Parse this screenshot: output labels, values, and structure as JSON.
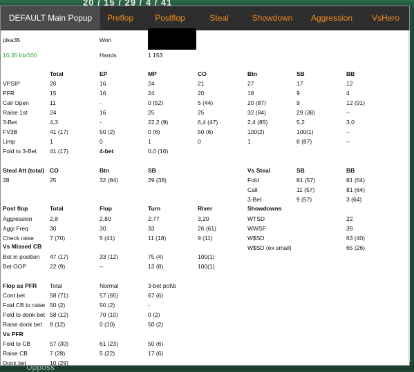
{
  "topbar": {
    "text": "20 / 15 / 29 / 4 / 41"
  },
  "bottom": {
    "text": "Upposs"
  },
  "tabs": [
    "DEFAULT Main Popup",
    "Preflop",
    "Postflop",
    "Steal",
    "Showdown",
    "Aggression",
    "VsHero"
  ],
  "player": {
    "name": "pika35",
    "won_label": "Won",
    "winrate": "10,35 bb/100",
    "hands_label": "Hands",
    "hands": "1 153"
  },
  "preflop": {
    "headers": [
      "Total",
      "EP",
      "MP",
      "CO",
      "Btn",
      "SB",
      "BB"
    ],
    "rows": [
      {
        "label": "VPSIP",
        "values": [
          "20",
          "16",
          "24",
          "21",
          "27",
          "17",
          "12"
        ]
      },
      {
        "label": "PFR",
        "values": [
          "15",
          "16",
          "24",
          "20",
          "18",
          "9",
          "4"
        ]
      },
      {
        "label": "Call Open",
        "values": [
          "11",
          "-",
          "0 (52)",
          "5 (44)",
          "20 (87)",
          "9",
          "12 (91)"
        ]
      },
      {
        "label": "Raise 1st",
        "values": [
          "24",
          "16",
          "25",
          "25",
          "32 (84)",
          "29 (38)",
          "--"
        ]
      },
      {
        "label": "3-Bet",
        "values": [
          "4,3",
          "-",
          "22,2 (9)",
          "6,4 (47)",
          "2,4 (85)",
          "5,2",
          "3,0"
        ]
      },
      {
        "label": "FV3B",
        "values": [
          "41 (17)",
          "50 (2)",
          "0 (6)",
          "50 (6)",
          "100(2)",
          "100(1)",
          "--"
        ]
      },
      {
        "label": "Limp",
        "values": [
          "1",
          "0",
          "1",
          "0",
          "1",
          "8 (87)",
          "--"
        ]
      },
      {
        "label": "Fold to 3-Bet",
        "values": [
          "41 (17)",
          "",
          "0,0 (16)",
          "",
          "",
          "",
          ""
        ]
      }
    ],
    "fourbet_label": "4-bet"
  },
  "steal": {
    "headers": [
      "Steal Att (total)",
      "CO",
      "Btn",
      "SB"
    ],
    "values": [
      "28",
      "25",
      "32 (84)",
      "29 (38)"
    ],
    "vs_headers": [
      "Vs Steal",
      "SB",
      "BB"
    ],
    "vs_rows": [
      {
        "label": "Fold",
        "values": [
          "81 (57)",
          "81 (64)"
        ]
      },
      {
        "label": "Call",
        "values": [
          "11 (57)",
          "81 (64)"
        ]
      },
      {
        "label": "3-Bet",
        "values": [
          "9 (57)",
          "3 (64)"
        ]
      }
    ]
  },
  "postflop": {
    "headers": [
      "Post flop",
      "Total",
      "Flop",
      "Turn",
      "River"
    ],
    "rows": [
      {
        "label": "Aggression",
        "values": [
          "2,8",
          "2,80",
          "2,77",
          "3,20"
        ]
      },
      {
        "label": "Aggi Freq",
        "values": [
          "30",
          "30",
          "33",
          "26 (61)"
        ]
      },
      {
        "label": "Check raise",
        "values": [
          "7 (70)",
          "5 (41)",
          "11 (18)",
          "9 (11)"
        ]
      }
    ],
    "missed_cb_label": "Vs Missed CB",
    "missed_rows": [
      {
        "label": "Bet in position",
        "values": [
          "47 (17)",
          "33 (12)",
          "75 (4)",
          "100(1)"
        ]
      },
      {
        "label": "Bet OOP",
        "values": [
          "22 (9)",
          "--",
          "13 (8)",
          "100(1)"
        ]
      }
    ]
  },
  "showdowns": {
    "title": "Showdowns",
    "rows": [
      {
        "label": "WTSD",
        "value": "22"
      },
      {
        "label": "WWSF",
        "value": "39"
      },
      {
        "label": "W$SD",
        "value": "63 (40)"
      },
      {
        "label": "W$SD (ex small)",
        "value": "65 (26)"
      }
    ]
  },
  "pfr": {
    "headers": [
      "Flop as PFR",
      "Total",
      "Normal",
      "3-bet pot\\b"
    ],
    "rows": [
      {
        "label": "Cont bet",
        "values": [
          "58 (71)",
          "57 (65)",
          "67 (6)"
        ]
      },
      {
        "label": "Fold CB to raise",
        "values": [
          "50 (2)",
          "50 (2)",
          "-"
        ]
      },
      {
        "label": "Fold to donk bet",
        "values": [
          "58 (12)",
          "70 (10)",
          "0 (2)"
        ]
      },
      {
        "label": "Raise donk bet",
        "values": [
          "8 (12)",
          "0 (10)",
          "50 (2)"
        ]
      }
    ],
    "vs_label": "Vs PFR",
    "vs_rows": [
      {
        "label": "Fold to CB",
        "values": [
          "57 (30)",
          "61 (23)",
          "50 (6)"
        ]
      },
      {
        "label": "Raise CB",
        "values": [
          "7 (28)",
          "5 (22)",
          "17 (6)"
        ]
      },
      {
        "label": "Donk bet",
        "values": [
          "10 (29)",
          "",
          ""
        ]
      }
    ]
  }
}
